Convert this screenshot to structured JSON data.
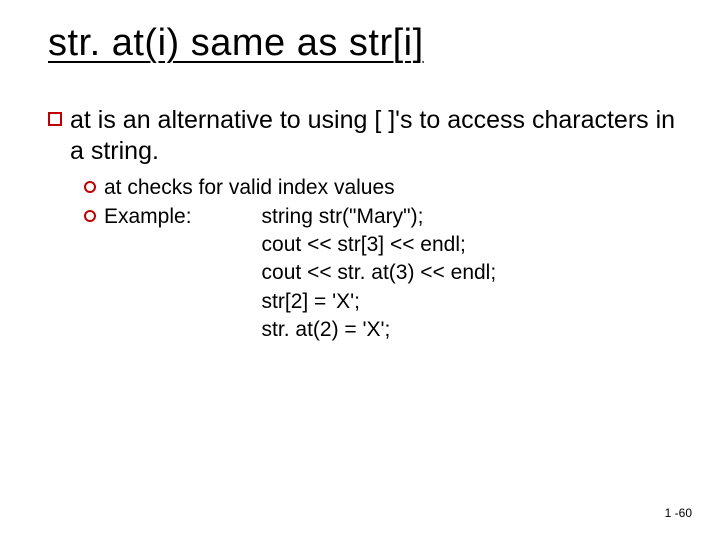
{
  "title": "str. at(i) same as str[i]",
  "main_bullet": "at is an alternative to using [ ]'s to access characters in a string.",
  "sub_bullets": {
    "check": "at checks for valid index values",
    "example_label": "Example:"
  },
  "code": {
    "l1": "string str(\"Mary\");",
    "l2": "cout << str[3] << endl;",
    "l3": "cout << str. at(3) << endl;",
    "l4": "str[2] = 'X';",
    "l5": "str. at(2) = 'X';"
  },
  "page_number": "1 -60"
}
